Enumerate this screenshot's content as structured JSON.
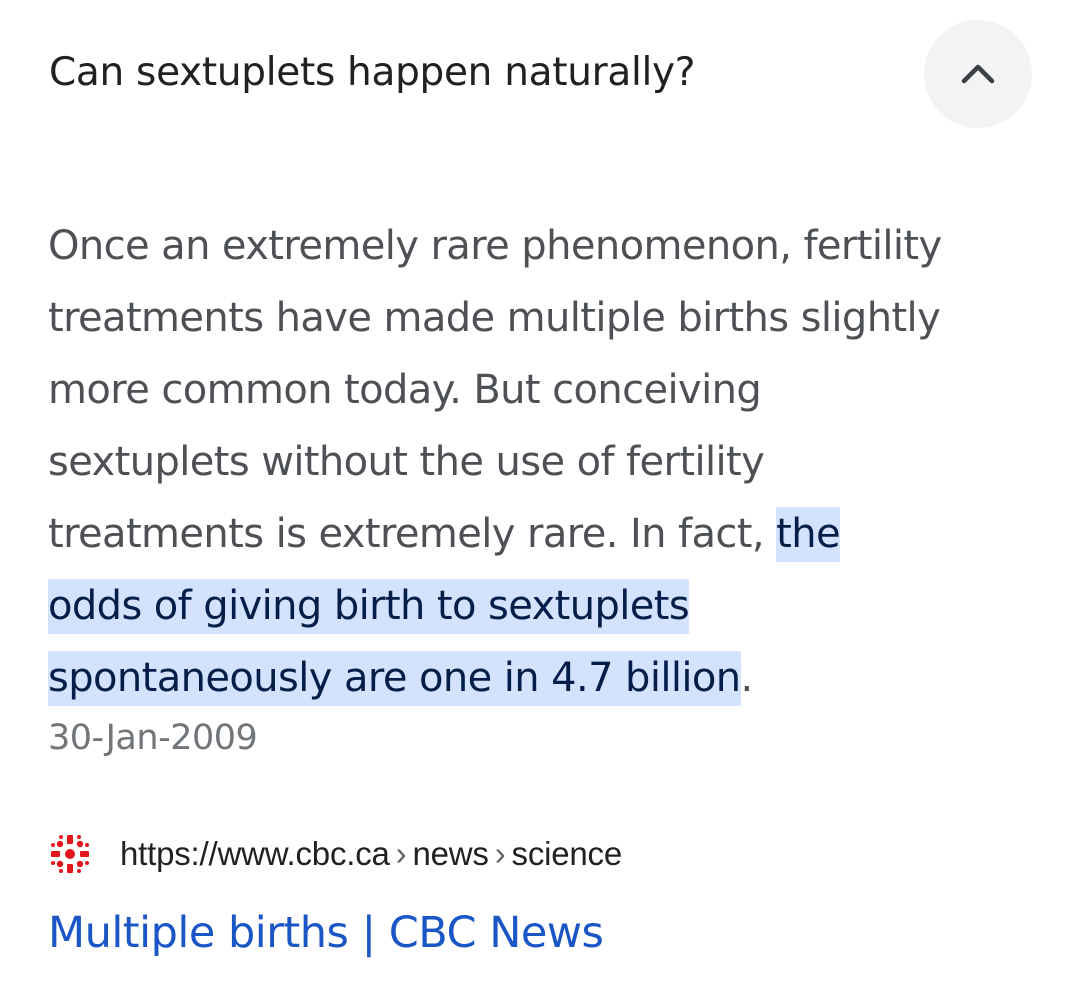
{
  "question": {
    "title": "Can sextuplets happen naturally?",
    "toggle_icon": "chevron-up-icon"
  },
  "answer": {
    "line1": "Once an extremely rare phenomenon, fertility",
    "line2": "treatments have made multiple births slightly",
    "line3": "more common today. But conceiving",
    "line4": "sextuplets without the use of fertility",
    "line5_plain": "treatments is extremely rare. In fact, ",
    "line5_highlight": "the",
    "line6_highlight": "odds of giving birth to sextuplets",
    "line7_highlight": "spontaneously are one in 4.7 billion",
    "line7_tail": ".",
    "date": "30-Jan-2009"
  },
  "source": {
    "favicon": "cbc-gem-icon",
    "url_base": "https://www.cbc.ca",
    "url_crumbs": [
      "news",
      "science"
    ],
    "separator": "›",
    "title": "Multiple births | CBC News"
  },
  "colors": {
    "highlight_bg": "#d3e3fd",
    "highlight_text": "#041e49",
    "link": "#1a56c6",
    "toggle_bg": "#f1f3f4",
    "brand_red": "#e3171d"
  }
}
